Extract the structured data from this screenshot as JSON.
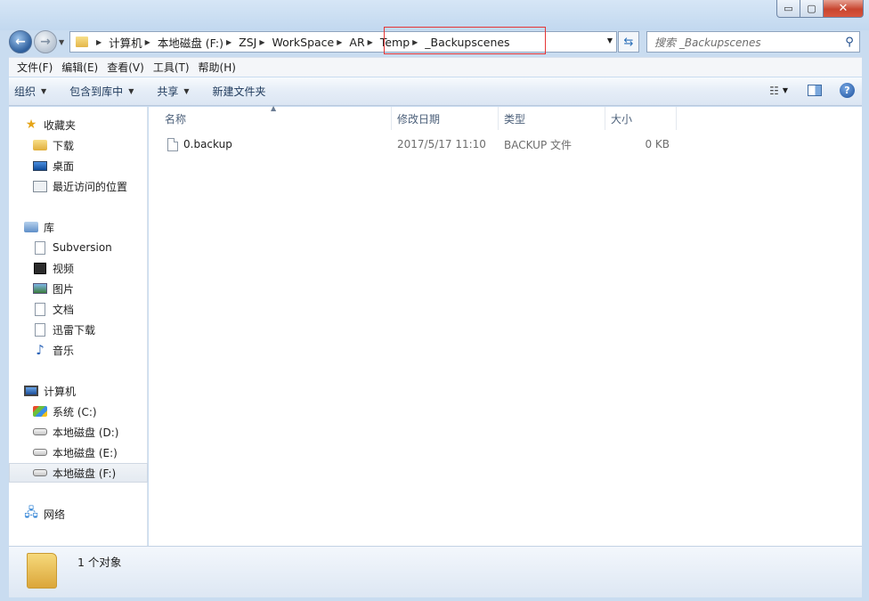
{
  "window": {
    "controls": {
      "minimize": "▭",
      "maximize": "▢",
      "close": "✕"
    }
  },
  "address_bar": {
    "crumbs": [
      "计算机",
      "本地磁盘 (F:)",
      "ZSJ",
      "WorkSpace",
      "AR",
      "Temp",
      "_Backupscenes"
    ]
  },
  "search": {
    "placeholder": "搜索 _Backupscenes"
  },
  "menu": [
    "文件(F)",
    "编辑(E)",
    "查看(V)",
    "工具(T)",
    "帮助(H)"
  ],
  "toolbar": {
    "organize": "组织",
    "include_in_library": "包含到库中",
    "share": "共享",
    "new_folder": "新建文件夹"
  },
  "sidebar": {
    "favorites_header": "收藏夹",
    "favorites": [
      "下载",
      "桌面",
      "最近访问的位置"
    ],
    "libraries_header": "库",
    "libraries": [
      "Subversion",
      "视频",
      "图片",
      "文档",
      "迅雷下载",
      "音乐"
    ],
    "computer_header": "计算机",
    "drives": [
      "系统 (C:)",
      "本地磁盘 (D:)",
      "本地磁盘 (E:)",
      "本地磁盘 (F:)"
    ],
    "selected_drive": "本地磁盘 (F:)",
    "network_header": "网络"
  },
  "file_list": {
    "columns": [
      "名称",
      "修改日期",
      "类型",
      "大小"
    ],
    "rows": [
      {
        "name": "0.backup",
        "modified": "2017/5/17 11:10",
        "type": "BACKUP 文件",
        "size": "0 KB"
      }
    ]
  },
  "status": {
    "item_count": "1 个对象"
  },
  "colors": {
    "highlight_box": "#e53535",
    "frame": "#c9dcf0"
  }
}
